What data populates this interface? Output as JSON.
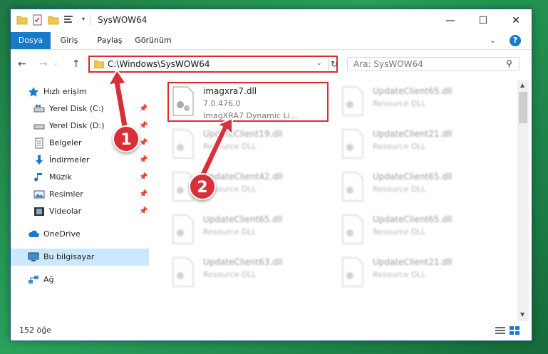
{
  "window": {
    "title": "SysWOW64",
    "min_icon": "—",
    "max_icon": "☐",
    "close_icon": "✕"
  },
  "ribbon": {
    "tabs": [
      "Dosya",
      "Giriş",
      "Paylaş",
      "Görünüm"
    ],
    "collapse_icon": "⌄",
    "help_label": "?"
  },
  "nav": {
    "back": "←",
    "forward": "→",
    "history": "⌄",
    "up": "↑",
    "address": "C:\\Windows\\SysWOW64",
    "address_dropdown": "⌄",
    "refresh": "↻",
    "search_placeholder": "Ara: SysWOW64",
    "search_icon": "⚲"
  },
  "sidebar": {
    "items": [
      {
        "label": "Hızlı erişim",
        "icon": "star-icon",
        "pinned": false
      },
      {
        "label": "Yerel Disk (C:)",
        "icon": "drive-icon",
        "pinned": true
      },
      {
        "label": "Yerel Disk (D:)",
        "icon": "drive-icon",
        "pinned": true
      },
      {
        "label": "Belgeler",
        "icon": "documents-icon",
        "pinned": true
      },
      {
        "label": "İndirmeler",
        "icon": "download-icon",
        "pinned": true
      },
      {
        "label": "Müzik",
        "icon": "music-icon",
        "pinned": true
      },
      {
        "label": "Resimler",
        "icon": "pictures-icon",
        "pinned": true
      },
      {
        "label": "Videolar",
        "icon": "videos-icon",
        "pinned": true
      },
      {
        "label": "OneDrive",
        "icon": "cloud-icon",
        "pinned": false
      },
      {
        "label": "Bu bilgisayar",
        "icon": "computer-icon",
        "pinned": false,
        "selected": true
      },
      {
        "label": "Ağ",
        "icon": "network-icon",
        "pinned": false
      }
    ],
    "pin_glyph": "📌"
  },
  "files": [
    {
      "name": "imagxra7.dll",
      "version": "7.0.476.0",
      "desc": "ImagXRA7 Dynamic Li...",
      "focus": true
    },
    {
      "name": "UpdateClient65.dll",
      "version": "Resource DLL",
      "desc": ""
    },
    {
      "name": "UpdateClient19.dll",
      "version": "Resource DLL",
      "desc": ""
    },
    {
      "name": "UpdateClient21.dll",
      "version": "Resource DLL",
      "desc": ""
    },
    {
      "name": "UpdateClient42.dll",
      "version": "Resource DLL",
      "desc": ""
    },
    {
      "name": "UpdateClient65.dll",
      "version": "Resource DLL",
      "desc": ""
    },
    {
      "name": "UpdateClient65.dll",
      "version": "Resource DLL",
      "desc": ""
    },
    {
      "name": "UpdateClient65.dll",
      "version": "Resource DLL",
      "desc": ""
    },
    {
      "name": "UpdateClient63.dll",
      "version": "Resource DLL",
      "desc": ""
    },
    {
      "name": "UpdateClient21.dll",
      "version": "Resource DLL",
      "desc": ""
    }
  ],
  "status": {
    "count": "152 öğe"
  },
  "annotations": {
    "badge1": "1",
    "badge2": "2",
    "color": "#d8303a"
  },
  "colors": {
    "accent": "#1979ca",
    "highlight": "#e0292f",
    "selected": "#cce8ff"
  }
}
